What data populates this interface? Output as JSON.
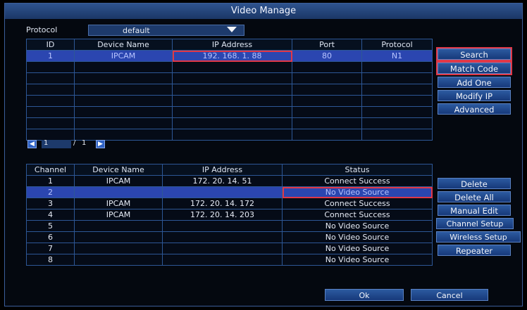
{
  "window": {
    "title": "Video Manage"
  },
  "protocol": {
    "label": "Protocol",
    "selected": "default"
  },
  "search_table": {
    "columns": [
      "ID",
      "Device Name",
      "IP Address",
      "Port",
      "Protocol"
    ],
    "rows": [
      {
        "id": "1",
        "device_name": "IPCAM",
        "ip": "192. 168. 1. 88",
        "port": "80",
        "protocol": "N1"
      }
    ],
    "empty_rows": 7
  },
  "side_buttons_top": [
    "Search",
    "Match Code",
    "Add One",
    "Modify IP",
    "Advanced"
  ],
  "pagination": {
    "current": "1",
    "separator": "/",
    "total": "1"
  },
  "channel_table": {
    "columns": [
      "Channel",
      "Device Name",
      "IP Address",
      "Status"
    ],
    "rows": [
      {
        "channel": "1",
        "device_name": "IPCAM",
        "ip": "172. 20. 14. 51",
        "status": "Connect Success"
      },
      {
        "channel": "2",
        "device_name": "",
        "ip": "",
        "status": "No Video Source"
      },
      {
        "channel": "3",
        "device_name": "IPCAM",
        "ip": "172. 20. 14. 172",
        "status": "Connect Success"
      },
      {
        "channel": "4",
        "device_name": "IPCAM",
        "ip": "172. 20. 14. 203",
        "status": "Connect Success"
      },
      {
        "channel": "5",
        "device_name": "",
        "ip": "",
        "status": "No Video Source"
      },
      {
        "channel": "6",
        "device_name": "",
        "ip": "",
        "status": "No Video Source"
      },
      {
        "channel": "7",
        "device_name": "",
        "ip": "",
        "status": "No Video Source"
      },
      {
        "channel": "8",
        "device_name": "",
        "ip": "",
        "status": "No Video Source"
      }
    ]
  },
  "side_buttons_bottom": [
    "Delete",
    "Delete All",
    "Manual Edit",
    "Channel Setup",
    "Wireless Setup",
    "Repeater"
  ],
  "footer": {
    "ok": "Ok",
    "cancel": "Cancel"
  },
  "colors": {
    "accent": "#2b46b0",
    "highlight": "#e03848",
    "grid": "#2d5796"
  }
}
